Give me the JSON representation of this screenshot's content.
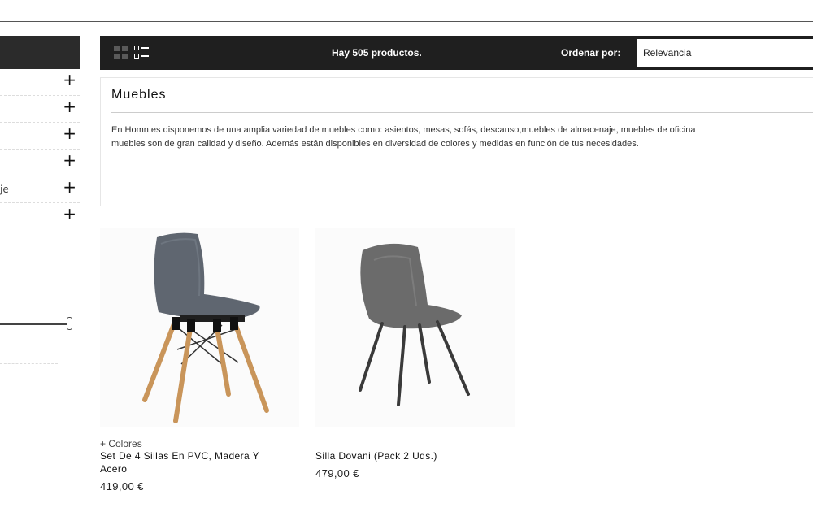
{
  "sidebar": {
    "categories": [
      {
        "label": ""
      },
      {
        "label": ""
      },
      {
        "label": ""
      },
      {
        "label": ""
      },
      {
        "label": "je"
      },
      {
        "label": ""
      }
    ],
    "expand_symbol": "+"
  },
  "toolbar": {
    "product_count": "Hay 505 productos.",
    "sort_label": "Ordenar por:",
    "sort_value": "Relevancia"
  },
  "category": {
    "title": "Muebles",
    "description_line1": "En Homn.es disponemos de una amplia variedad de muebles como: asientos, mesas, sofás, descanso,muebles de almacenaje, muebles de oficina",
    "description_line2": "muebles son de gran calidad y diseño. Además están disponibles en diversidad de colores y medidas en función de tus necesidades."
  },
  "products": [
    {
      "colors": "+ Colores",
      "name": "Set De 4 Sillas En PVC, Madera Y Acero",
      "price": "419,00 €"
    },
    {
      "colors": "",
      "name": "Silla Dovani (Pack 2 Uds.)",
      "price": "479,00 €"
    }
  ],
  "colors": {
    "toolbar_bg": "#1f1f1f",
    "sidebar_head_bg": "#2b2b2b",
    "chair1_seat": "#5f6670",
    "chair1_legs": "#c9955a",
    "chair2_seat": "#6b6b6b"
  }
}
